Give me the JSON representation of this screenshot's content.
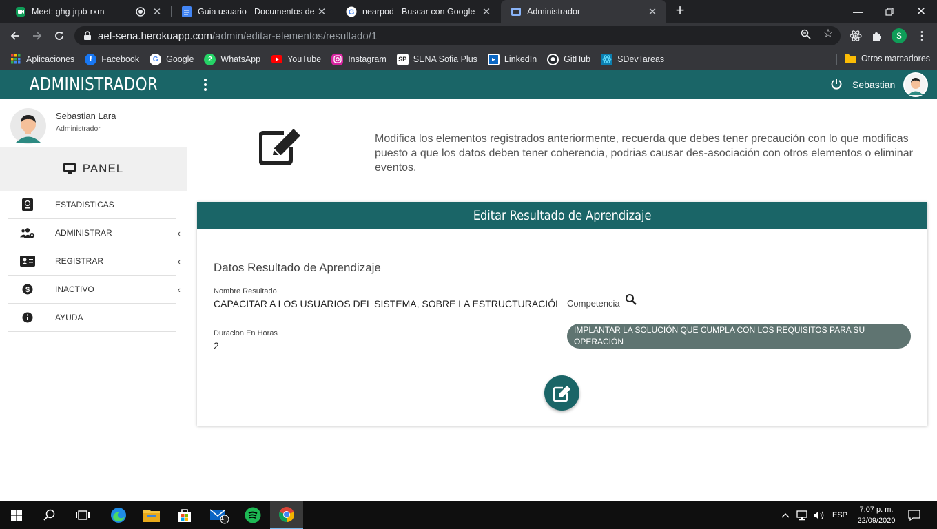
{
  "browser": {
    "tabs": [
      {
        "title": "Meet: ghg-jrpb-rxm",
        "active": false
      },
      {
        "title": "Guia usuario - Documentos de Google",
        "active": false
      },
      {
        "title": "nearpod - Buscar con Google",
        "active": false
      },
      {
        "title": "Administrador",
        "active": true
      }
    ],
    "url_host": "aef-sena.herokuapp.com",
    "url_path": "/admin/editar-elementos/resultado/1",
    "profile_initial": "S",
    "bookmarks": [
      "Aplicaciones",
      "Facebook",
      "Google",
      "WhatsApp",
      "YouTube",
      "Instagram",
      "SENA Sofia Plus",
      "LinkedIn",
      "GitHub",
      "SDevTareas"
    ],
    "other_bookmarks": "Otros marcadores"
  },
  "header": {
    "brand": "ADMINISTRADOR",
    "username": "Sebastian"
  },
  "sidebar": {
    "user_name": "Sebastian Lara",
    "user_role": "Administrador",
    "panel_label": "PANEL",
    "items": [
      {
        "label": "ESTADISTICAS",
        "icon": "passport-icon",
        "has_submenu": false
      },
      {
        "label": "ADMINISTRAR",
        "icon": "users-cog-icon",
        "has_submenu": true
      },
      {
        "label": "REGISTRAR",
        "icon": "id-card-icon",
        "has_submenu": true
      },
      {
        "label": "INACTIVO",
        "icon": "dollar-icon",
        "has_submenu": true
      },
      {
        "label": "AYUDA",
        "icon": "info-icon",
        "has_submenu": false
      }
    ]
  },
  "main": {
    "intro_text": "Modifica los elementos registrados anteriormente, recuerda que debes tener precaución con lo que modificas puesto a que los datos deben tener coherencia, podrias causar des-asociación con otros elementos o eliminar eventos.",
    "card_title": "Editar Resultado de Aprendizaje",
    "section_title": "Datos Resultado de Aprendizaje",
    "nombre_label": "Nombre Resultado",
    "nombre_value": "CAPACITAR A LOS USUARIOS DEL SISTEMA, SOBRE LA ESTRUCTURACIÓN",
    "duracion_label": "Duracion En Horas",
    "duracion_value": "2",
    "competencia_label": "Competencia",
    "competencia_value": "IMPLANTAR LA SOLUCIÓN QUE CUMPLA CON LOS REQUISITOS PARA SU OPERACIÓN"
  },
  "taskbar": {
    "language": "ESP",
    "time": "7:07 p. m.",
    "date": "22/09/2020",
    "mail_badge": "1"
  },
  "colors": {
    "primary": "#1a6567",
    "chip": "#5f7471",
    "chrome_dark": "#202124",
    "chrome_toolbar": "#35363a"
  }
}
